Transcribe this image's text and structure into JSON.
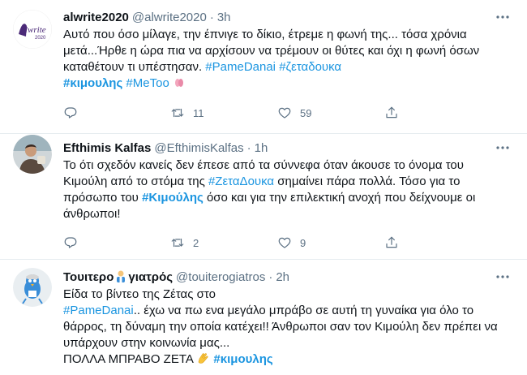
{
  "tweets": [
    {
      "name": "alwrite2020",
      "handle": "@alwrite2020",
      "dot": "·",
      "time": "3h",
      "avatar_text": "alwrite 2020",
      "text_plain": "Αυτό που όσο μίλαγε, την έπνιγε το δίκιο, έτρεμε η φωνή της... τόσα χρόνια μετά...Ήρθε η ώρα πια να αρχίσουν να τρέμουν οι θύτες και όχι η φωνή όσων καταθέτουν τι υπέστησαν. ",
      "hashtag1": "#PameDanai",
      "hashtag2": "#ζεταδουκα",
      "hashtag3": "#κιμουλης",
      "hashtag4": "#MeToo",
      "replies": "",
      "retweets": "11",
      "likes": "59"
    },
    {
      "name": "Efthimis Kalfas",
      "handle": "@EfthimisKalfas",
      "dot": "·",
      "time": "1h",
      "text_a": "Το ότι σχεδόν κανείς δεν έπεσε από τα σύννεφα όταν άκουσε το όνομα του Κιμούλη από το στόμα της ",
      "hashtag1": "#ΖεταΔουκα",
      "text_b": " σημαίνει πάρα πολλά. Τόσο για το πρόσωπο του ",
      "hashtag2": "#Κιμούλης",
      "text_c": " όσο και για την επιλεκτική ανοχή που δείχνουμε οι άνθρωποι!",
      "replies": "",
      "retweets": "2",
      "likes": "9"
    },
    {
      "name_a": "Τουιτερο",
      "name_b": "γιατρός",
      "handle": "@touiterogiatros",
      "dot": "·",
      "time": "2h",
      "text_a": "Είδα το βίντεο της Ζέτας στο",
      "hashtag1": "#PameDanai",
      "text_b": ".. έχω να πω ενα μεγάλο μπράβο σε αυτή τη γυναίκα για όλο το θάρρος, τη δύναμη την οποία κατέχει!! Άνθρωποι σαν τον Κιμούλη δεν πρέπει να υπάρχουν στην κοινωνία μας...",
      "text_c": "ΠΟΛΛΑ ΜΠΡΑΒΟ ΖΕΤΑ ",
      "hashtag2": "#κιμουλης"
    }
  ],
  "colors": {
    "link": "#1b95e0",
    "muted": "#5b7083",
    "divider": "#e6ecf0"
  },
  "icons": [
    "reply-icon",
    "retweet-icon",
    "like-icon",
    "share-icon",
    "more-icon",
    "clap-emoji",
    "doctor-emoji",
    "pink-hands-emoji"
  ]
}
